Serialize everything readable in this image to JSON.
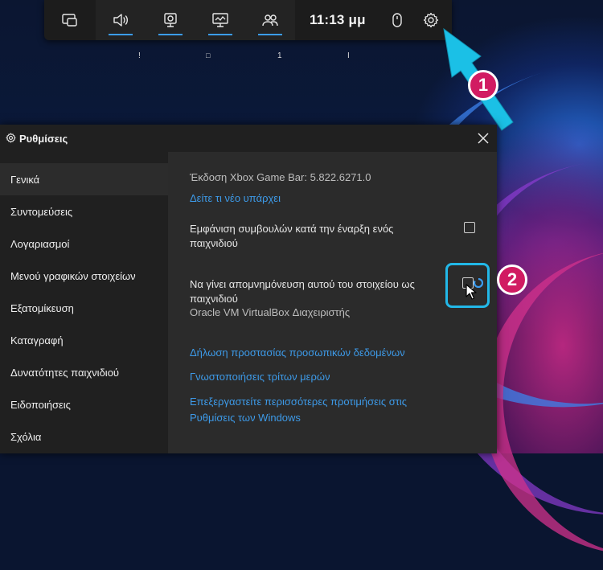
{
  "gamebar": {
    "time": "11:13 μμ",
    "buttons": [
      {
        "icon": "widget-menu-icon"
      },
      {
        "icon": "audio-icon",
        "active": true
      },
      {
        "icon": "capture-icon",
        "active": true
      },
      {
        "icon": "performance-icon",
        "active": true
      },
      {
        "icon": "social-icon",
        "active": true
      }
    ],
    "right_icons": [
      "mouse-icon",
      "settings-gear-icon"
    ],
    "widget_labels": [
      "!",
      "□",
      "1",
      "I"
    ]
  },
  "callouts": [
    "1",
    "2"
  ],
  "settings": {
    "title": "Ρυθμίσεις",
    "sidebar": [
      {
        "label": "Γενικά",
        "active": true
      },
      {
        "label": "Συντομεύσεις"
      },
      {
        "label": "Λογαριασμοί"
      },
      {
        "label": "Μενού γραφικών στοιχείων"
      },
      {
        "label": "Εξατομίκευση"
      },
      {
        "label": "Καταγραφή"
      },
      {
        "label": "Δυνατότητες παιχνιδιού"
      },
      {
        "label": "Ειδοποιήσεις"
      },
      {
        "label": "Σχόλια"
      }
    ],
    "version": "Έκδοση Xbox Game Bar: 5.822.6271.0",
    "whats_new": "Δείτε τι νέο υπάρχει",
    "tips_line1": "Εμφάνιση συμβουλών κατά την έναρξη ενός",
    "tips_line2": "παιχνιδιού",
    "remember_line1": "Να γίνει απομνημόνευση αυτού του στοιχείου ως",
    "remember_line2": "παιχνιδιού",
    "app_name": "Oracle VM VirtualBox Διαχειριστής",
    "privacy_link": "Δήλωση προστασίας προσωπικών δεδομένων",
    "third_party_link": "Γνωστοποιήσεις τρίτων μερών",
    "more_prefs_line1": "Επεξεργαστείτε περισσότερες προτιμήσεις στις",
    "more_prefs_line2": "Ρυθμίσεις των Windows"
  },
  "colors": {
    "accent": "#3b9cf0",
    "link": "#3d9ae8",
    "callout": "#d11b62",
    "highlight": "#22b8e8"
  }
}
